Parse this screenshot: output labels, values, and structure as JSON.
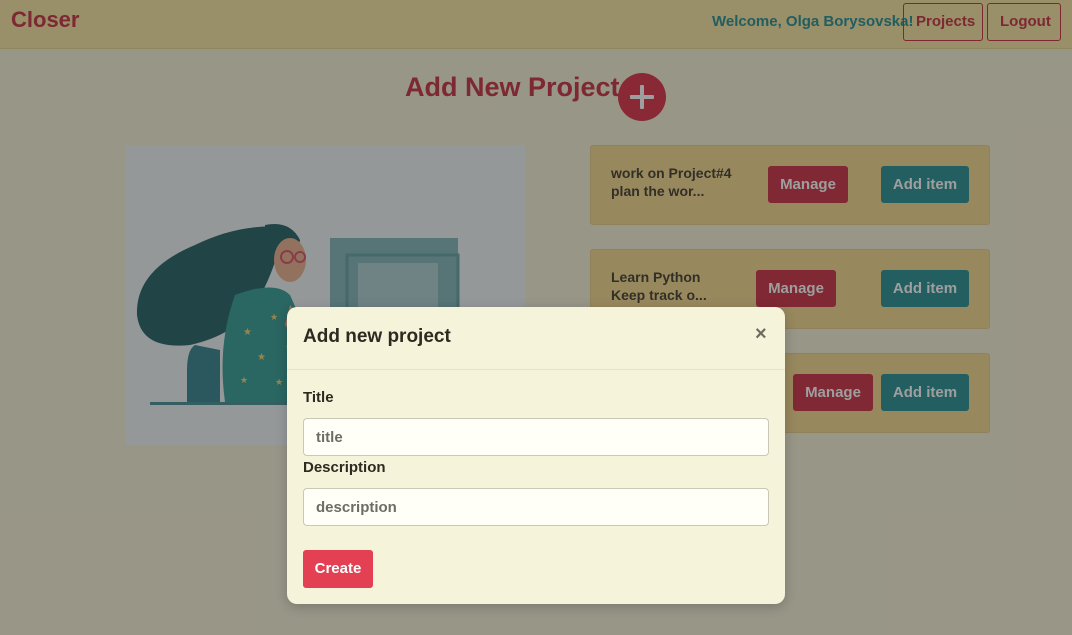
{
  "navbar": {
    "brand": "Closer",
    "welcome": "Welcome, Olga Borysovska!",
    "projects_label": "Projects",
    "logout_label": "Logout"
  },
  "page": {
    "heading": "Add New Project",
    "add_icon": "plus-icon"
  },
  "projects": [
    {
      "title": "work on Project#4",
      "description": "plan the wor...",
      "manage_label": "Manage",
      "add_item_label": "Add item"
    },
    {
      "title": "Learn Python",
      "description": "Keep track o...",
      "manage_label": "Manage",
      "add_item_label": "Add item"
    },
    {
      "title": "",
      "description": "",
      "manage_label": "Manage",
      "add_item_label": "Add item"
    }
  ],
  "modal": {
    "title": "Add new project",
    "close": "×",
    "title_label": "Title",
    "title_placeholder": "title",
    "description_label": "Description",
    "description_placeholder": "description",
    "create_label": "Create"
  },
  "colors": {
    "navbar_bg": "#f6e39d",
    "brand": "#c3283b",
    "welcome": "#1e8b8f",
    "manage_button": "#c8293c",
    "add_item_button": "#1f8d91",
    "create_button": "#e34054",
    "card_bg": "#f5d88a",
    "modal_bg": "#f6f3db"
  }
}
